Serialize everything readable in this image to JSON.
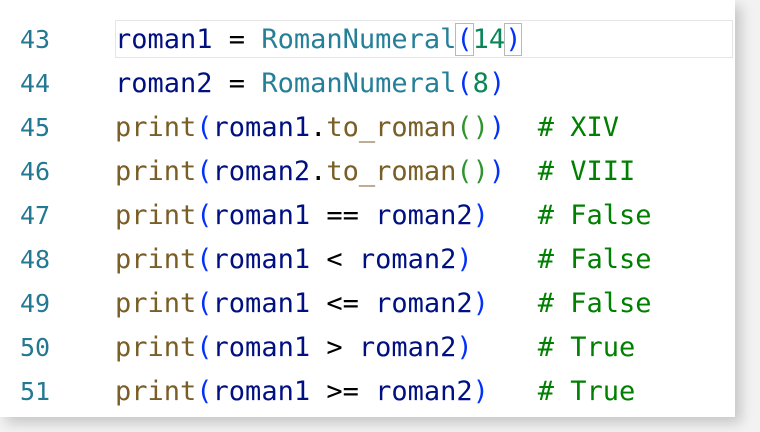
{
  "editor": {
    "lines": [
      {
        "number": "43",
        "current": true,
        "tokens": [
          {
            "text": "roman1",
            "type": "id"
          },
          {
            "text": " = ",
            "type": "op"
          },
          {
            "text": "RomanNumeral",
            "type": "cls"
          },
          {
            "text": "(",
            "type": "br1",
            "match": true
          },
          {
            "text": "14",
            "type": "num"
          },
          {
            "text": ")",
            "type": "br1",
            "match": true
          }
        ]
      },
      {
        "number": "44",
        "tokens": [
          {
            "text": "roman2",
            "type": "id"
          },
          {
            "text": " = ",
            "type": "op"
          },
          {
            "text": "RomanNumeral",
            "type": "cls"
          },
          {
            "text": "(",
            "type": "br1"
          },
          {
            "text": "8",
            "type": "num"
          },
          {
            "text": ")",
            "type": "br1"
          }
        ]
      },
      {
        "number": "45",
        "tokens": [
          {
            "text": "print",
            "type": "fn"
          },
          {
            "text": "(",
            "type": "br1"
          },
          {
            "text": "roman1",
            "type": "id"
          },
          {
            "text": ".",
            "type": "op"
          },
          {
            "text": "to_roman",
            "type": "fn"
          },
          {
            "text": "()",
            "type": "br2"
          },
          {
            "text": ")",
            "type": "br1"
          },
          {
            "text": "  ",
            "type": "op"
          },
          {
            "text": "# XIV",
            "type": "com"
          }
        ]
      },
      {
        "number": "46",
        "tokens": [
          {
            "text": "print",
            "type": "fn"
          },
          {
            "text": "(",
            "type": "br1"
          },
          {
            "text": "roman2",
            "type": "id"
          },
          {
            "text": ".",
            "type": "op"
          },
          {
            "text": "to_roman",
            "type": "fn"
          },
          {
            "text": "()",
            "type": "br2"
          },
          {
            "text": ")",
            "type": "br1"
          },
          {
            "text": "  ",
            "type": "op"
          },
          {
            "text": "# VIII",
            "type": "com"
          }
        ]
      },
      {
        "number": "47",
        "tokens": [
          {
            "text": "print",
            "type": "fn"
          },
          {
            "text": "(",
            "type": "br1"
          },
          {
            "text": "roman1",
            "type": "id"
          },
          {
            "text": " == ",
            "type": "op"
          },
          {
            "text": "roman2",
            "type": "id"
          },
          {
            "text": ")",
            "type": "br1"
          },
          {
            "text": "   ",
            "type": "op"
          },
          {
            "text": "# False",
            "type": "com"
          }
        ]
      },
      {
        "number": "48",
        "tokens": [
          {
            "text": "print",
            "type": "fn"
          },
          {
            "text": "(",
            "type": "br1"
          },
          {
            "text": "roman1",
            "type": "id"
          },
          {
            "text": " < ",
            "type": "op"
          },
          {
            "text": "roman2",
            "type": "id"
          },
          {
            "text": ")",
            "type": "br1"
          },
          {
            "text": "    ",
            "type": "op"
          },
          {
            "text": "# False",
            "type": "com"
          }
        ]
      },
      {
        "number": "49",
        "tokens": [
          {
            "text": "print",
            "type": "fn"
          },
          {
            "text": "(",
            "type": "br1"
          },
          {
            "text": "roman1",
            "type": "id"
          },
          {
            "text": " <= ",
            "type": "op"
          },
          {
            "text": "roman2",
            "type": "id"
          },
          {
            "text": ")",
            "type": "br1"
          },
          {
            "text": "   ",
            "type": "op"
          },
          {
            "text": "# False",
            "type": "com"
          }
        ]
      },
      {
        "number": "50",
        "tokens": [
          {
            "text": "print",
            "type": "fn"
          },
          {
            "text": "(",
            "type": "br1"
          },
          {
            "text": "roman1",
            "type": "id"
          },
          {
            "text": " > ",
            "type": "op"
          },
          {
            "text": "roman2",
            "type": "id"
          },
          {
            "text": ")",
            "type": "br1"
          },
          {
            "text": "    ",
            "type": "op"
          },
          {
            "text": "# True",
            "type": "com"
          }
        ]
      },
      {
        "number": "51",
        "tokens": [
          {
            "text": "print",
            "type": "fn"
          },
          {
            "text": "(",
            "type": "br1"
          },
          {
            "text": "roman1",
            "type": "id"
          },
          {
            "text": " >= ",
            "type": "op"
          },
          {
            "text": "roman2",
            "type": "id"
          },
          {
            "text": ")",
            "type": "br1"
          },
          {
            "text": "   ",
            "type": "op"
          },
          {
            "text": "# True",
            "type": "com"
          }
        ]
      }
    ]
  }
}
